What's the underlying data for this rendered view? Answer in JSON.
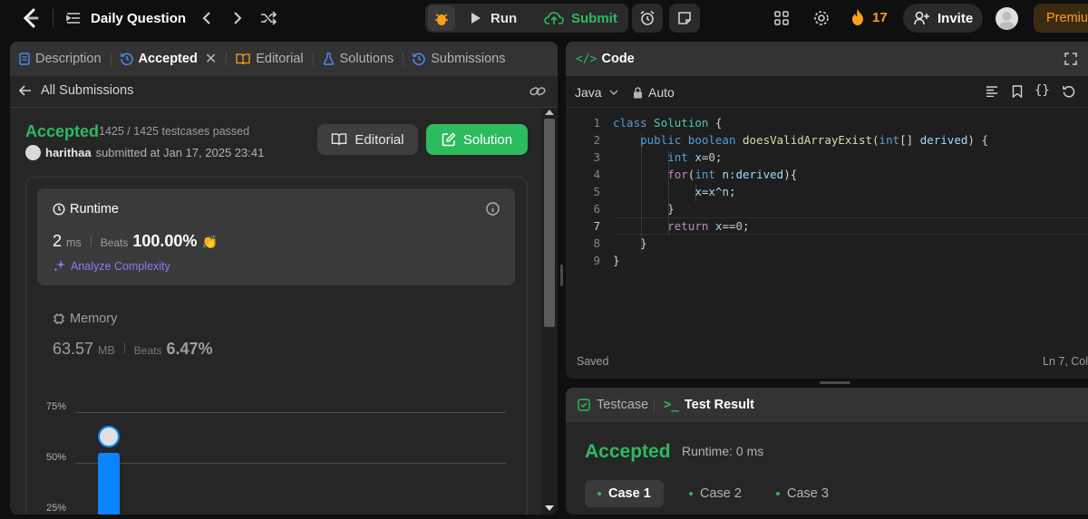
{
  "topbar": {
    "problem_list_label": "Daily Question",
    "run_label": "Run",
    "submit_label": "Submit",
    "streak_count": "17",
    "invite_label": "Invite",
    "premium_label": "Premiu"
  },
  "left_tabs": [
    {
      "label": "Description"
    },
    {
      "label": "Accepted"
    },
    {
      "label": "Editorial"
    },
    {
      "label": "Solutions"
    },
    {
      "label": "Submissions"
    }
  ],
  "submission": {
    "back_label": "All Submissions",
    "status": "Accepted",
    "testcases": "1425 / 1425 testcases passed",
    "username": "harithaa",
    "submitted_text": "submitted at Jan 17, 2025 23:41",
    "editorial_btn": "Editorial",
    "solution_btn": "Solution"
  },
  "runtime": {
    "title": "Runtime",
    "value": "2",
    "unit": "ms",
    "beats_label": "Beats",
    "beats_value": "100.00%",
    "analyze_label": "Analyze Complexity"
  },
  "memory": {
    "title": "Memory",
    "value": "63.57",
    "unit": "MB",
    "beats_label": "Beats",
    "beats_value": "6.47%"
  },
  "chart_data": {
    "type": "bar",
    "y_ticks": [
      "75%",
      "50%",
      "25%"
    ],
    "values": [
      55
    ],
    "ylim": [
      20,
      80
    ]
  },
  "editor": {
    "title": "Code",
    "language": "Java",
    "mode": "Auto",
    "status": "Saved",
    "cursor": "Ln 7, Col",
    "line_numbers": [
      "1",
      "2",
      "3",
      "4",
      "5",
      "6",
      "7",
      "8",
      "9"
    ]
  },
  "test_panel": {
    "testcase_tab": "Testcase",
    "result_tab": "Test Result",
    "status": "Accepted",
    "runtime": "Runtime: 0 ms",
    "cases": [
      "Case 1",
      "Case 2",
      "Case 3"
    ]
  },
  "colors": {
    "accent_green": "#2cbb5d",
    "accent_blue": "#0a84ff",
    "streak_orange": "#ffa116"
  }
}
